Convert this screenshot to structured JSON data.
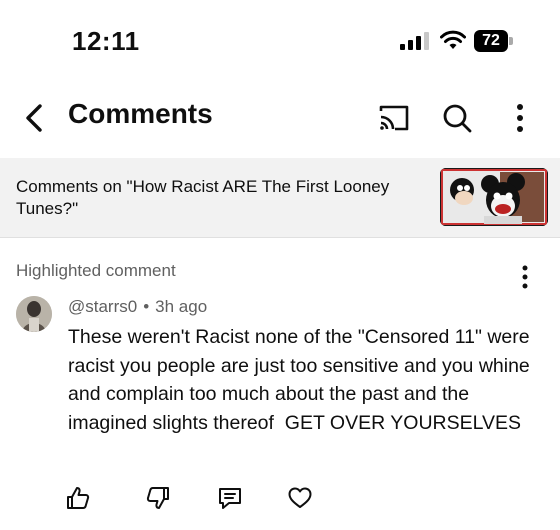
{
  "status_bar": {
    "time": "12:11",
    "battery": "72"
  },
  "header": {
    "title": "Comments",
    "icons": [
      "back-arrow-icon",
      "cast-icon",
      "search-icon",
      "more-vert-icon"
    ]
  },
  "video": {
    "context_text": "Comments on \"How Racist ARE The First Looney Tunes?\"",
    "thumbnail": "video-thumbnail"
  },
  "highlighted": {
    "label": "Highlighted comment",
    "comment": {
      "author": "@starrs0",
      "separator": "•",
      "time": "3h ago",
      "text": "These weren't Racist none of the \"Censored 11\" were racist you people are just too sensitive and you whine and complain too much about the past and the imagined slights thereof  GET OVER YOURSELVES"
    },
    "actions": [
      "like-icon",
      "dislike-icon",
      "reply-icon",
      "heart-icon"
    ]
  },
  "colors": {
    "text": "#0f0f0f",
    "secondary_text": "#606060",
    "context_bar_bg": "#f2f2f2"
  }
}
